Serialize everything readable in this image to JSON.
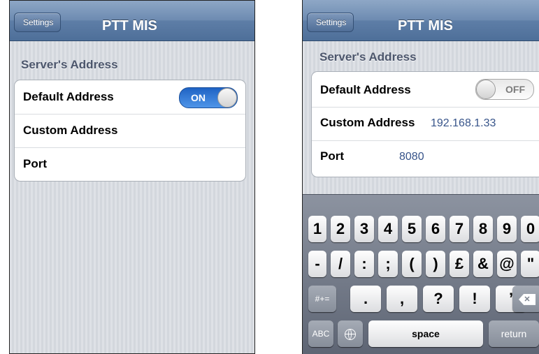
{
  "left_screen": {
    "back_label": "Settings",
    "title": "PTT MIS",
    "section_header": "Server's Address",
    "rows": [
      {
        "label": "Default Address",
        "toggle": "ON"
      },
      {
        "label": "Custom Address",
        "value": ""
      },
      {
        "label": "Port",
        "value": ""
      }
    ]
  },
  "right_screen": {
    "back_label": "Settings",
    "title": "PTT MIS",
    "section_header": "Server's Address",
    "rows": [
      {
        "label": "Default Address",
        "toggle": "OFF"
      },
      {
        "label": "Custom Address",
        "value": "192.168.1.33"
      },
      {
        "label": "Port",
        "value": "8080"
      }
    ],
    "keyboard": {
      "row1": [
        "1",
        "2",
        "3",
        "4",
        "5",
        "6",
        "7",
        "8",
        "9",
        "0"
      ],
      "row2": [
        "-",
        "/",
        ":",
        ";",
        "(",
        ")",
        "£",
        "&",
        "@",
        "\""
      ],
      "row3": {
        "mode_key": "#+=",
        "keys": [
          ".",
          ",",
          "?",
          "!",
          "’"
        ],
        "delete_icon": "backspace-icon"
      },
      "row4": {
        "abc_key": "ABC",
        "globe_icon": "globe-icon",
        "space": "space",
        "return": "return"
      }
    }
  },
  "colors": {
    "navbar": "#5e7ea7",
    "toggle_on": "#2f7ad8",
    "value_text": "#37548a",
    "background": "#d7dbe1"
  }
}
